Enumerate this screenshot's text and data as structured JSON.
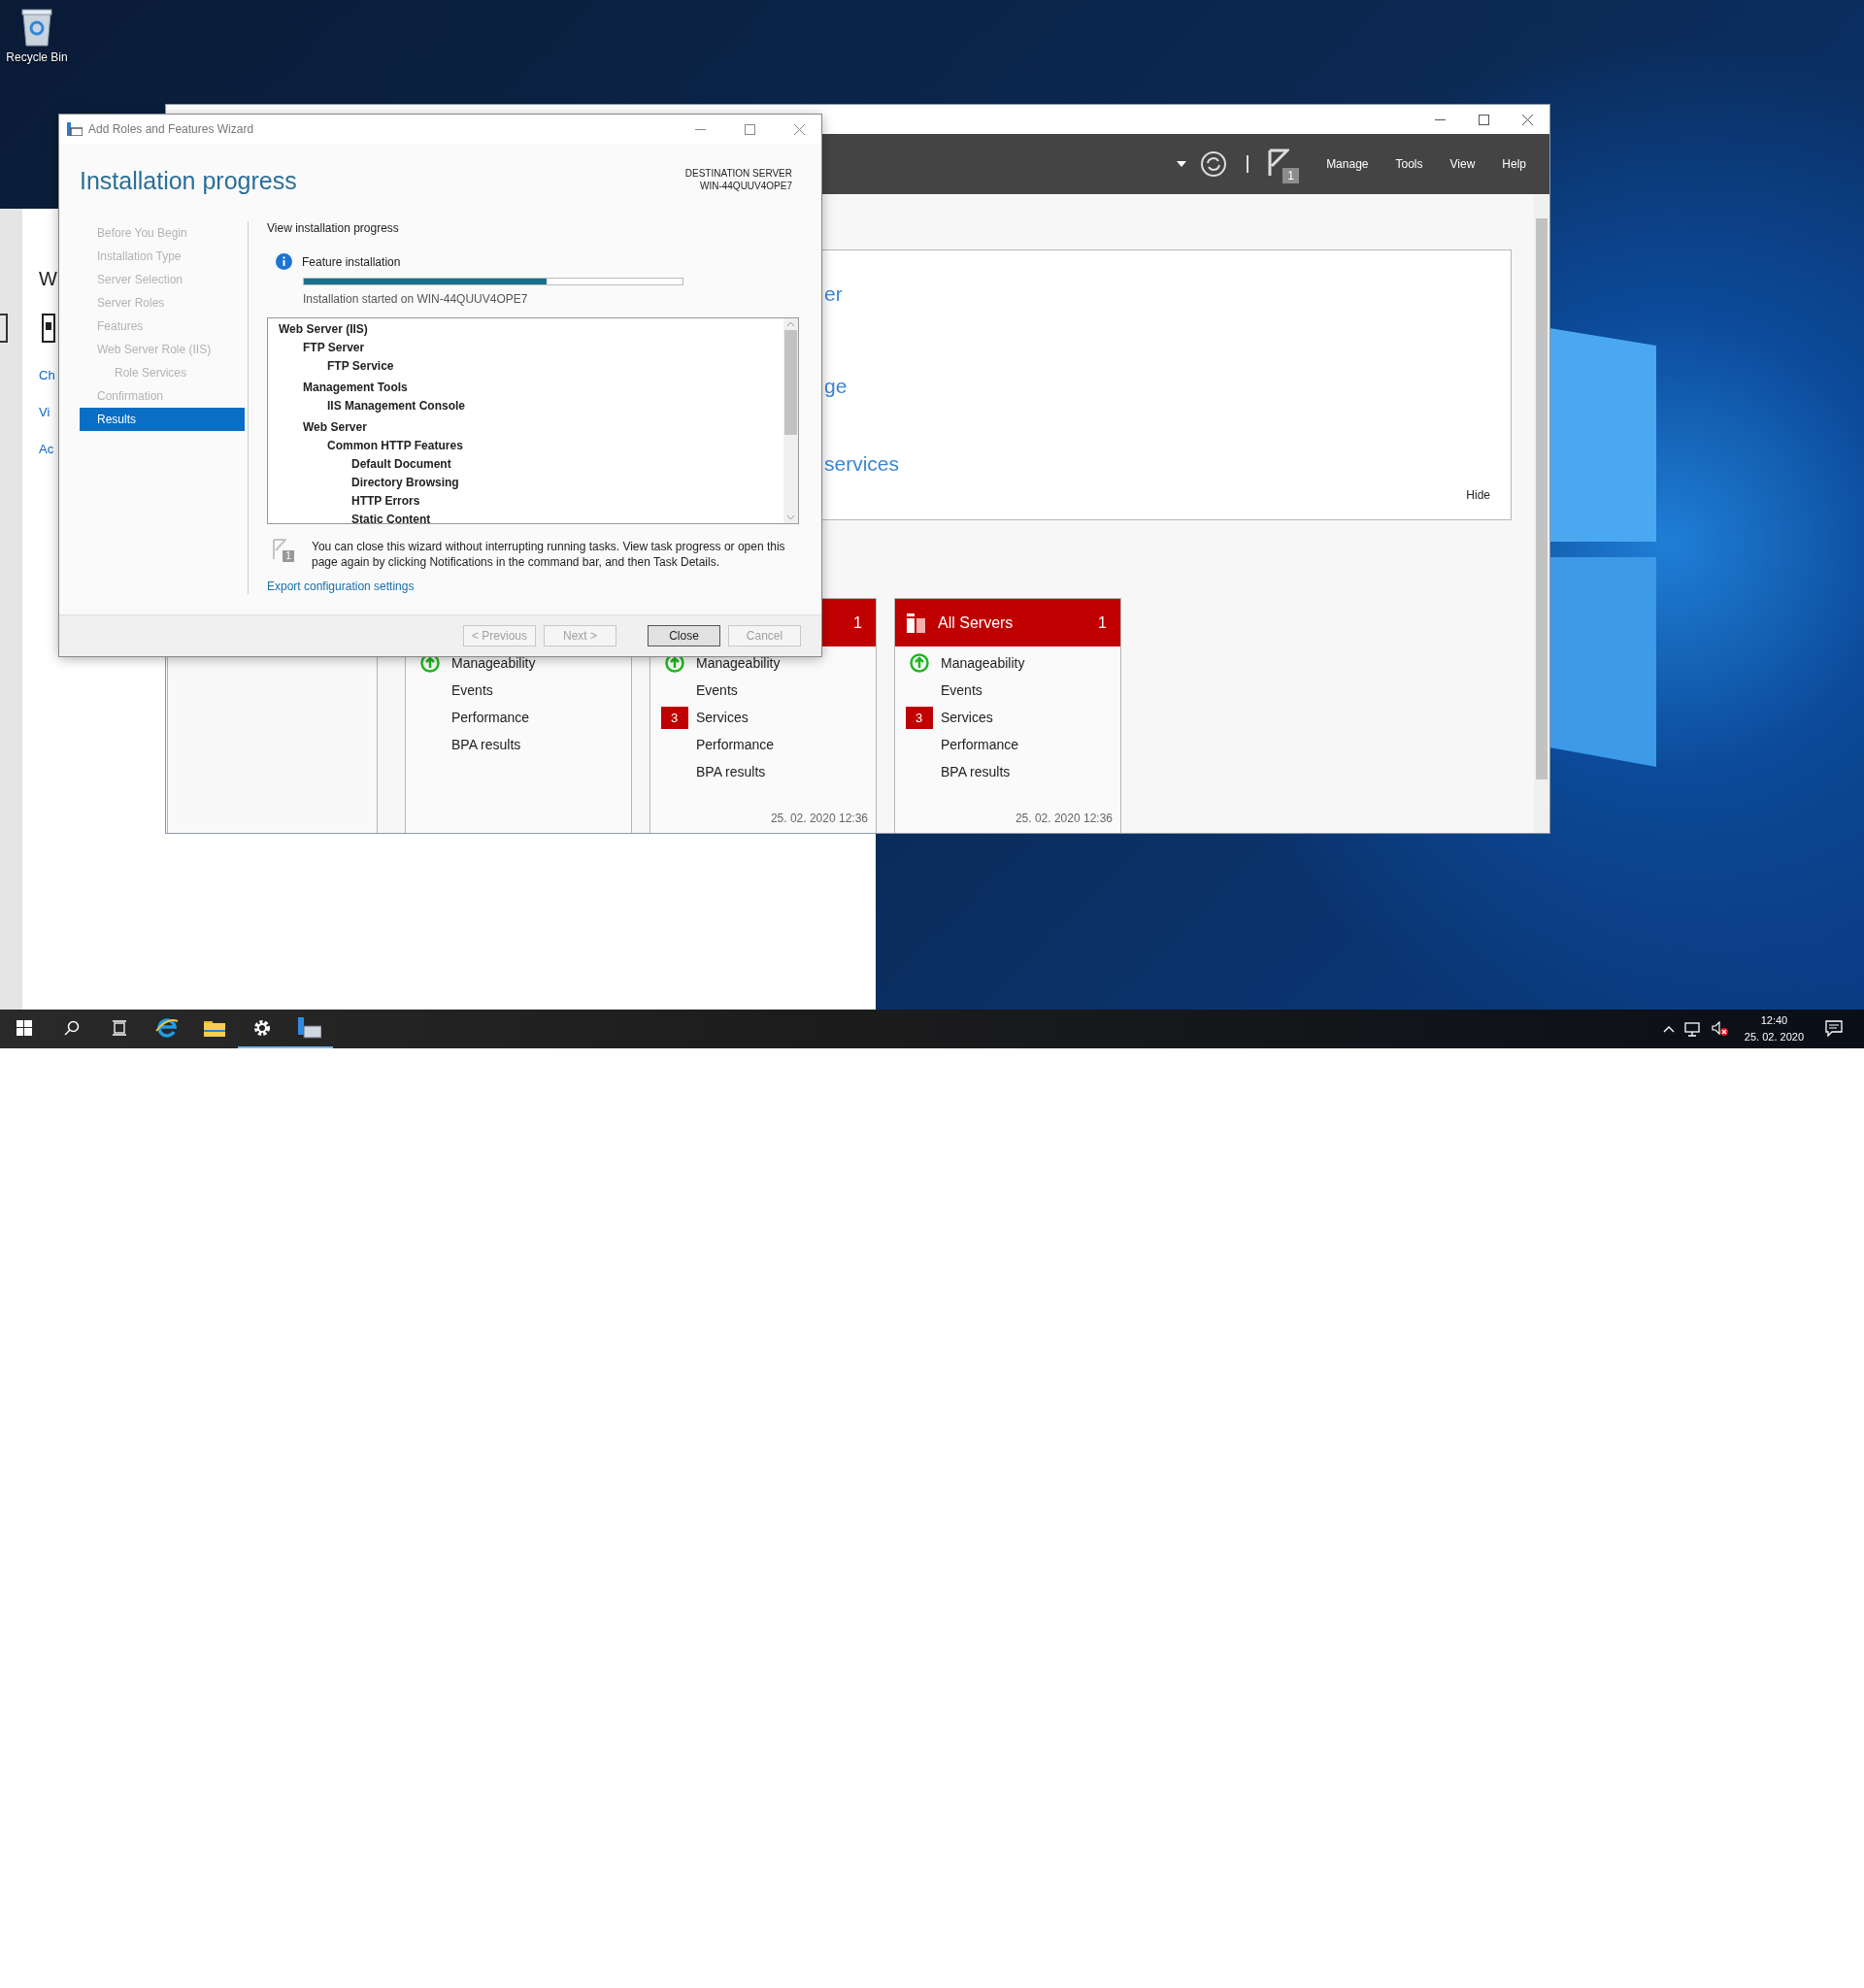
{
  "desktop": {
    "icons": [
      {
        "label": "Recycle Bin"
      }
    ]
  },
  "back_window": {
    "heading": "W",
    "links": [
      "Ch",
      "Vi",
      "Ac"
    ]
  },
  "server_manager": {
    "toolbar": {
      "flag_count": "1",
      "menus": [
        "Manage",
        "Tools",
        "View",
        "Help"
      ]
    },
    "welcome": {
      "fragments": [
        "er",
        "ge",
        "services"
      ],
      "hide": "Hide"
    },
    "tiles": [
      {
        "items": [
          {
            "kind": "ok",
            "label": "Manageability"
          },
          {
            "kind": "plain",
            "label": "Events"
          },
          {
            "kind": "plain",
            "label": "Performance"
          },
          {
            "kind": "plain",
            "label": "BPA results"
          }
        ]
      },
      {
        "count": "1",
        "items": [
          {
            "kind": "ok",
            "label": "Manageability"
          },
          {
            "kind": "plain",
            "label": "Events"
          },
          {
            "kind": "alert",
            "badge": "3",
            "label": "Services"
          },
          {
            "kind": "plain",
            "label": "Performance"
          },
          {
            "kind": "plain",
            "label": "BPA results"
          }
        ],
        "timestamp": "25. 02. 2020 12:36"
      },
      {
        "title": "All Servers",
        "count": "1",
        "items": [
          {
            "kind": "ok",
            "label": "Manageability"
          },
          {
            "kind": "plain",
            "label": "Events"
          },
          {
            "kind": "alert",
            "badge": "3",
            "label": "Services"
          },
          {
            "kind": "plain",
            "label": "Performance"
          },
          {
            "kind": "plain",
            "label": "BPA results"
          }
        ],
        "timestamp": "25. 02. 2020 12:36"
      }
    ]
  },
  "wizard": {
    "title": "Add Roles and Features Wizard",
    "heading": "Installation progress",
    "destination_label": "DESTINATION SERVER",
    "destination_server": "WIN-44QUUV4OPE7",
    "steps": [
      {
        "label": "Before You Begin",
        "selected": false
      },
      {
        "label": "Installation Type",
        "selected": false
      },
      {
        "label": "Server Selection",
        "selected": false
      },
      {
        "label": "Server Roles",
        "selected": false
      },
      {
        "label": "Features",
        "selected": false
      },
      {
        "label": "Web Server Role (IIS)",
        "selected": false,
        "children": [
          {
            "label": "Role Services",
            "selected": false
          }
        ]
      },
      {
        "label": "Confirmation",
        "selected": false
      },
      {
        "label": "Results",
        "selected": true
      }
    ],
    "section_title": "View installation progress",
    "progress": {
      "label": "Feature installation",
      "level": 0.64,
      "note": "Installation started on WIN-44QUUV4OPE7"
    },
    "features": [
      {
        "label": "Web Server (IIS)",
        "children": [
          {
            "label": "FTP Server",
            "children": [
              {
                "label": "FTP Service"
              }
            ]
          },
          {
            "label": "Management Tools",
            "children": [
              {
                "label": "IIS Management Console"
              }
            ]
          },
          {
            "label": "Web Server",
            "children": [
              {
                "label": "Common HTTP Features",
                "children": [
                  {
                    "label": "Default Document"
                  },
                  {
                    "label": "Directory Browsing"
                  },
                  {
                    "label": "HTTP Errors"
                  },
                  {
                    "label": "Static Content"
                  }
                ]
              }
            ]
          }
        ]
      }
    ],
    "notice": "You can close this wizard without interrupting running tasks. View task progress or open this page again by clicking Notifications in the command bar, and then Task Details.",
    "notice_count": "1",
    "link": "Export configuration settings",
    "buttons": [
      {
        "label": "< Previous",
        "disabled": true,
        "default": false
      },
      {
        "label": "Next >",
        "disabled": true,
        "default": false
      },
      {
        "label": "Close",
        "disabled": false,
        "default": true
      },
      {
        "label": "Cancel",
        "disabled": true,
        "default": false
      }
    ]
  },
  "taskbar": {
    "apps": [
      {
        "kind": "start",
        "running": false
      },
      {
        "kind": "search",
        "running": false
      },
      {
        "kind": "taskview",
        "running": false
      },
      {
        "kind": "browser",
        "running": false
      },
      {
        "kind": "folder",
        "running": false
      },
      {
        "kind": "settings",
        "running": true
      },
      {
        "kind": "servermanager",
        "running": true
      }
    ],
    "clock": {
      "time": "12:40",
      "date": "25. 02. 2020"
    }
  }
}
